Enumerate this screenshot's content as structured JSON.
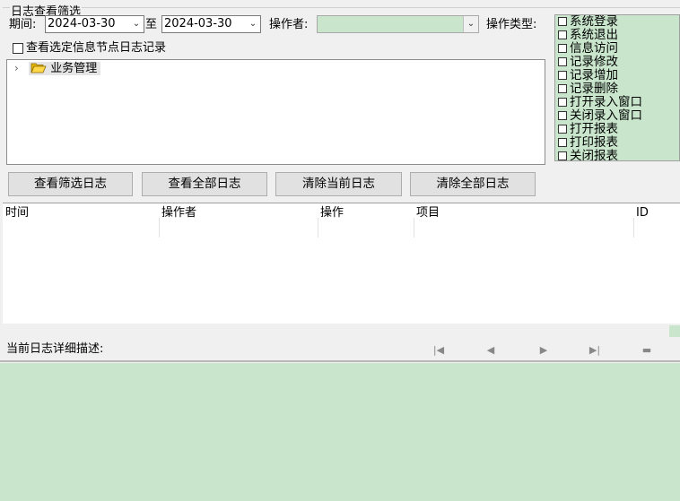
{
  "filter": {
    "group_title": "日志查看筛选",
    "period_label": "期间:",
    "date_from": "2024-03-30",
    "to_label": "至",
    "date_to": "2024-03-30",
    "operator_label": "操作者:",
    "operator_value": "",
    "optype_label": "操作类型:",
    "selected_node_only_label": "查看选定信息节点日志记录",
    "optypes": [
      "系统登录",
      "系统退出",
      "信息访问",
      "记录修改",
      "记录增加",
      "记录删除",
      "打开录入窗口",
      "关闭录入窗口",
      "打开报表",
      "打印报表",
      "关闭报表"
    ]
  },
  "tree": {
    "root_label": "业务管理"
  },
  "buttons": {
    "view_filtered": "查看筛选日志",
    "view_all": "查看全部日志",
    "clear_current": "清除当前日志",
    "clear_all": "清除全部日志"
  },
  "grid": {
    "columns": [
      "时间",
      "操作者",
      "操作",
      "项目",
      "ID"
    ]
  },
  "detail": {
    "label": "当前日志详细描述:",
    "nav_icons": [
      "first-icon",
      "prev-icon",
      "next-icon",
      "last-icon",
      "delete-icon"
    ]
  },
  "colors": {
    "panel_green": "#c9e6cd",
    "window_bg": "#f0f0f0"
  }
}
